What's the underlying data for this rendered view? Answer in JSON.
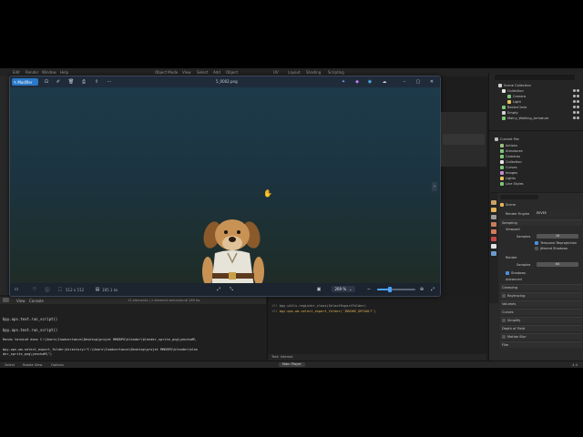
{
  "blender": {
    "menus": [
      "Edit",
      "Render",
      "Window",
      "Help",
      "Object Mode",
      "View",
      "Select",
      "Add",
      "Object",
      "UV",
      "Layout",
      "Shading",
      "Scripting"
    ],
    "outliner": {
      "items": [
        {
          "label": "Scene Collection",
          "color": "#d0d0d0"
        },
        {
          "label": "Collection",
          "color": "#d0d0d0"
        },
        {
          "label": "Camera",
          "color": "#7fc77a"
        },
        {
          "label": "Light",
          "color": "#e8c35a"
        },
        {
          "label": "BezierCircle",
          "color": "#7fc77a"
        },
        {
          "label": "Empty",
          "color": "#d0d0d0"
        },
        {
          "label": "Mainy_Walking_Armature",
          "color": "#7fc77a"
        }
      ]
    },
    "current_file": {
      "title": "Current File",
      "items": [
        "Actions",
        "Armatures",
        "Cameras",
        "Collection",
        "Curves",
        "Images",
        "Lights",
        "Line Styles"
      ]
    },
    "properties": {
      "scene": "Scene",
      "render_engine_label": "Render Engine",
      "render_engine_value": "EEVEE",
      "sampling": "Sampling",
      "viewport": "Viewport",
      "samples_label": "Samples",
      "viewport_samples": "16",
      "temporal": "Temporal Reprojection",
      "jittered": "Jittered Shadows",
      "render": "Render",
      "render_samples": "64",
      "shadows": "Shadows",
      "advanced": "Advanced",
      "sections": [
        "Clamping",
        "Raytracing",
        "Volumes",
        "Curves",
        "Simplify",
        "Depth of Field",
        "Motion Blur",
        "Film"
      ]
    }
  },
  "viewer": {
    "modifier_button": "Modifier",
    "filename": "5_0002.png",
    "dimensions": "512 x 512",
    "filesize": "185.1 ko",
    "zoom": "269 %",
    "zoom_fraction": 0.34
  },
  "console": {
    "header_items": [
      "View",
      "Console"
    ],
    "lines": [
      "bpy.ops.text.run_script()",
      "bpy.ops.text.run_script()",
      "Rendu terminé dans C:\\Users\\Inadvertance\\Desktop\\projet MMORPG\\blender\\blender_sprite_png\\yenchaM\\",
      "bpy.ops.wm.select_export_folder(directory=\"C:\\Users\\Inadvertance\\Desktop\\projet MMORPG\\blender\\blen",
      "der_sprite_png\\yenchaM\\\")"
    ],
    "elements_summary": "13 elements |  1 element selectionné  189 Ko"
  },
  "text_editor": {
    "lines": [
      "bpy.utils.register_class(SelectExportFolder)",
      "bpy.ops.wm.select_export_folder('INVOKE_DEFAULT')"
    ],
    "line_numbers": [
      "131",
      "132"
    ],
    "footer": "Text: Internal"
  },
  "status": {
    "items": [
      "Select",
      "Rotate View",
      "Options"
    ],
    "mid_tab": "Main Player",
    "version": "4.4"
  }
}
